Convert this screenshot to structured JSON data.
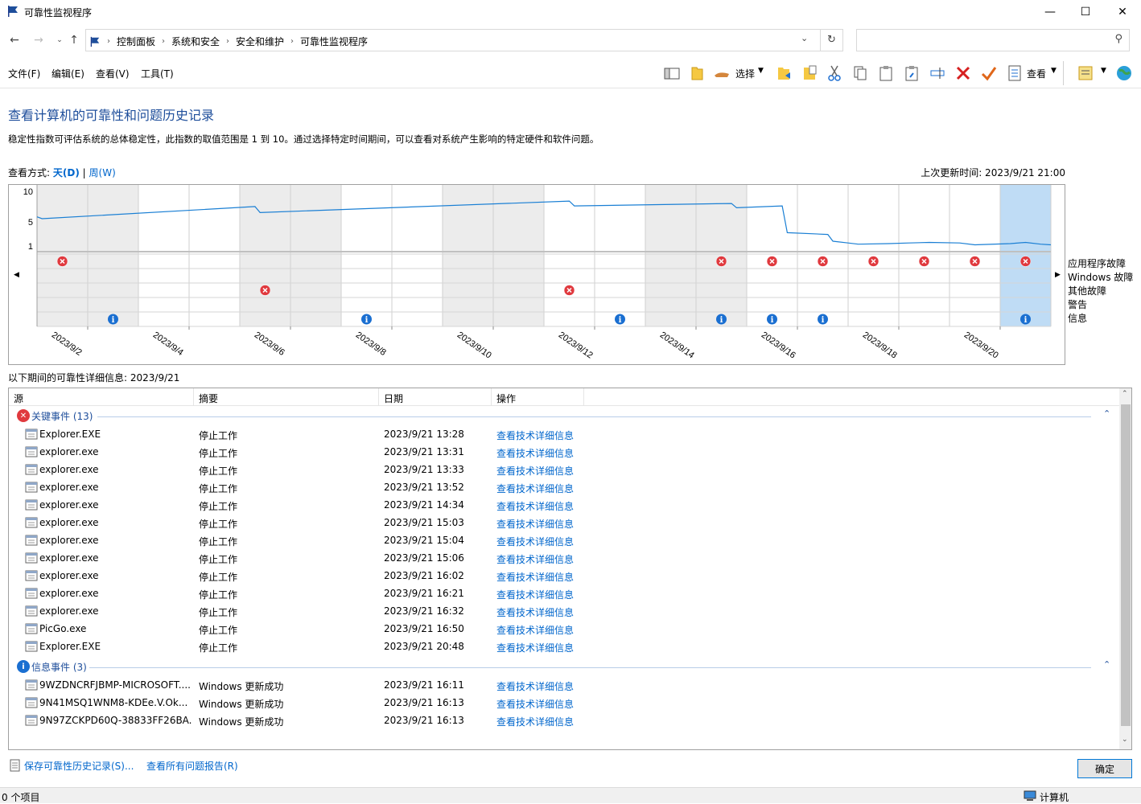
{
  "window": {
    "title": "可靠性监视程序",
    "minimize": "—",
    "maximize": "☐",
    "close": "✕"
  },
  "address": {
    "crumbs": [
      "控制面板",
      "系统和安全",
      "安全和维护",
      "可靠性监视程序"
    ],
    "search_placeholder": ""
  },
  "menu": [
    "文件(F)",
    "编辑(E)",
    "查看(V)",
    "工具(T)"
  ],
  "toolbar": {
    "select_label": "选择",
    "view_label": "查看"
  },
  "page": {
    "heading": "查看计算机的可靠性和问题历史记录",
    "description": "稳定性指数可评估系统的总体稳定性，此指数的取值范围是 1 到 10。通过选择特定时间期间，可以查看对系统产生影响的特定硬件和软件问题。",
    "view_mode_label": "查看方式:",
    "view_day": "天(D)",
    "view_sep": "|",
    "view_week": "周(W)",
    "last_updated": "上次更新时间: 2023/9/21 21:00"
  },
  "chart_data": {
    "type": "line",
    "y_ticks": [
      "10",
      "5",
      "1"
    ],
    "ylim": [
      1,
      10
    ],
    "dates": [
      "2023/9/2",
      "2023/9/4",
      "2023/9/6",
      "2023/9/8",
      "2023/9/10",
      "2023/9/12",
      "2023/9/14",
      "2023/9/16",
      "2023/9/18",
      "2023/9/20"
    ],
    "days": [
      "9/2",
      "9/3",
      "9/4",
      "9/5",
      "9/6",
      "9/7",
      "9/8",
      "9/9",
      "9/10",
      "9/11",
      "9/12",
      "9/13",
      "9/14",
      "9/15",
      "9/16",
      "9/17",
      "9/18",
      "9/19",
      "9/20",
      "9/21"
    ],
    "stability_points": [
      [
        0,
        5.8
      ],
      [
        0.1,
        5.5
      ],
      [
        4.3,
        7.5
      ],
      [
        4.4,
        6.5
      ],
      [
        10.5,
        8.4
      ],
      [
        10.6,
        7.6
      ],
      [
        13.7,
        8.0
      ],
      [
        13.8,
        7.3
      ],
      [
        14.7,
        7.6
      ],
      [
        14.8,
        3.2
      ],
      [
        15.6,
        2.9
      ],
      [
        15.7,
        1.8
      ],
      [
        16.0,
        1.5
      ],
      [
        16.2,
        1.3
      ],
      [
        16.8,
        1.4
      ],
      [
        17.2,
        1.5
      ],
      [
        17.6,
        1.6
      ],
      [
        18.2,
        1.5
      ],
      [
        18.5,
        1.2
      ],
      [
        19.2,
        1.4
      ],
      [
        19.5,
        1.6
      ],
      [
        19.8,
        1.3
      ],
      [
        20,
        1.2
      ]
    ],
    "rows": [
      "应用程序故障",
      "Windows 故障",
      "其他故障",
      "警告",
      "信息"
    ],
    "events": {
      "app_failure_days": [
        0,
        13,
        14,
        15,
        16,
        17,
        18,
        19
      ],
      "other_failure_days": [
        4,
        10
      ],
      "info_days": [
        1,
        6,
        11,
        13,
        14,
        15,
        19
      ]
    },
    "selected_day": 19
  },
  "details": {
    "title": "以下期间的可靠性详细信息: 2023/9/21",
    "columns": [
      "源",
      "摘要",
      "日期",
      "操作"
    ],
    "groups": [
      {
        "name": "关键事件 (13)",
        "type": "critical",
        "rows": [
          [
            "Explorer.EXE",
            "停止工作",
            "2023/9/21 13:28",
            "查看技术详细信息"
          ],
          [
            "explorer.exe",
            "停止工作",
            "2023/9/21 13:31",
            "查看技术详细信息"
          ],
          [
            "explorer.exe",
            "停止工作",
            "2023/9/21 13:33",
            "查看技术详细信息"
          ],
          [
            "explorer.exe",
            "停止工作",
            "2023/9/21 13:52",
            "查看技术详细信息"
          ],
          [
            "explorer.exe",
            "停止工作",
            "2023/9/21 14:34",
            "查看技术详细信息"
          ],
          [
            "explorer.exe",
            "停止工作",
            "2023/9/21 15:03",
            "查看技术详细信息"
          ],
          [
            "explorer.exe",
            "停止工作",
            "2023/9/21 15:04",
            "查看技术详细信息"
          ],
          [
            "explorer.exe",
            "停止工作",
            "2023/9/21 15:06",
            "查看技术详细信息"
          ],
          [
            "explorer.exe",
            "停止工作",
            "2023/9/21 16:02",
            "查看技术详细信息"
          ],
          [
            "explorer.exe",
            "停止工作",
            "2023/9/21 16:21",
            "查看技术详细信息"
          ],
          [
            "explorer.exe",
            "停止工作",
            "2023/9/21 16:32",
            "查看技术详细信息"
          ],
          [
            "PicGo.exe",
            "停止工作",
            "2023/9/21 16:50",
            "查看技术详细信息"
          ],
          [
            "Explorer.EXE",
            "停止工作",
            "2023/9/21 20:48",
            "查看技术详细信息"
          ]
        ]
      },
      {
        "name": "信息事件 (3)",
        "type": "info",
        "rows": [
          [
            "9WZDNCRFJBMP-MICROSOFT....",
            "Windows 更新成功",
            "2023/9/21 16:11",
            "查看技术详细信息"
          ],
          [
            "9N41MSQ1WNM8-KDEe.V.Ok...",
            "Windows 更新成功",
            "2023/9/21 16:13",
            "查看技术详细信息"
          ],
          [
            "9N97ZCKPD60Q-38833FF26BA...",
            "Windows 更新成功",
            "2023/9/21 16:13",
            "查看技术详细信息"
          ]
        ]
      }
    ]
  },
  "footer": {
    "save_link": "保存可靠性历史记录(S)...",
    "all_reports_link": "查看所有问题报告(R)",
    "ok": "确定"
  },
  "status": {
    "items": "0 个项目",
    "computer": "计算机"
  },
  "colors": {
    "link": "#0066cc",
    "heading": "#1e4e9b",
    "line": "#1a7fd4",
    "error": "#e0393e",
    "info": "#1a6fd1",
    "selected": "#bfdcf5"
  }
}
